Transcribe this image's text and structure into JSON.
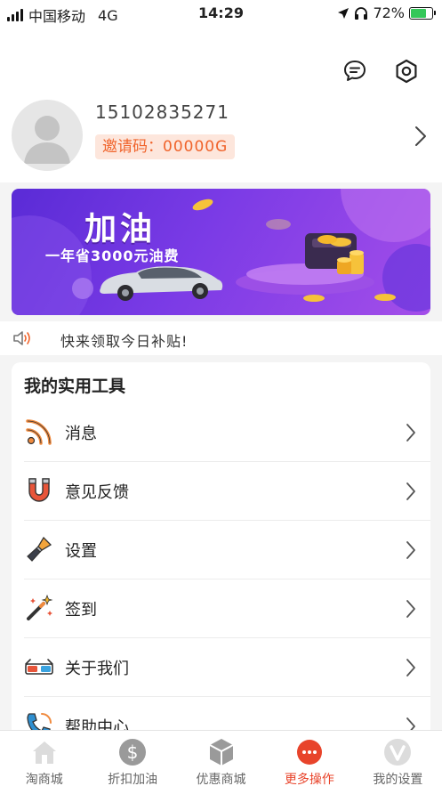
{
  "status_bar": {
    "carrier": "中国移动",
    "network": "4G",
    "time": "14:29",
    "battery": "72%",
    "battery_level": 0.72
  },
  "header": {
    "icons": [
      "message-icon",
      "settings-hex-icon"
    ],
    "phone": "15102835271",
    "invite_label": "邀请码：",
    "invite_code": "00000G"
  },
  "banner": {
    "title": "加油",
    "subtitle": "一年省3000元油费"
  },
  "notice": {
    "text": "快来领取今日补贴!"
  },
  "tools": {
    "heading": "我的实用工具",
    "items": [
      {
        "label": "消息",
        "icon": "rss-icon"
      },
      {
        "label": "意见反馈",
        "icon": "magnet-icon"
      },
      {
        "label": "设置",
        "icon": "paintbrush-icon"
      },
      {
        "label": "签到",
        "icon": "magic-wand-icon"
      },
      {
        "label": "关于我们",
        "icon": "3d-glasses-icon"
      },
      {
        "label": "帮助中心",
        "icon": "phone-icon"
      }
    ]
  },
  "tabbar": {
    "active_index": 3,
    "tabs": [
      {
        "label": "淘商城",
        "icon": "home-icon"
      },
      {
        "label": "折扣加油",
        "icon": "dollar-icon"
      },
      {
        "label": "优惠商城",
        "icon": "box-icon"
      },
      {
        "label": "更多操作",
        "icon": "more-icon"
      },
      {
        "label": "我的设置",
        "icon": "profile-v-icon"
      }
    ]
  },
  "colors": {
    "accent": "#e8442b",
    "invite_text": "#f0642c",
    "invite_bg": "#fde6dc",
    "banner_start": "#5a2bd6",
    "banner_end": "#a44ee9"
  }
}
